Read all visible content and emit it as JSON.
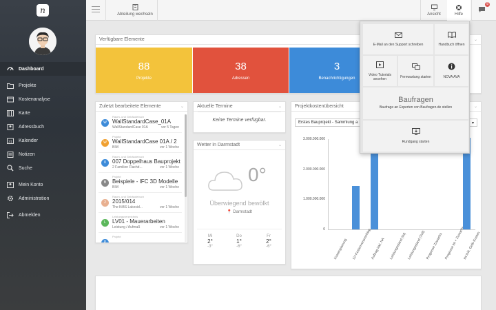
{
  "app": {
    "logo_letter": "n"
  },
  "sidebar": {
    "items": [
      {
        "label": "Dashboard",
        "icon": "speedometer-icon"
      },
      {
        "label": "Projekte",
        "icon": "folder-icon"
      },
      {
        "label": "Kostenanalyse",
        "icon": "calculator-icon"
      },
      {
        "label": "Karte",
        "icon": "map-icon"
      },
      {
        "label": "Adressbuch",
        "icon": "address-book-icon"
      },
      {
        "label": "Kalender",
        "icon": "calendar-icon"
      },
      {
        "label": "Notizen",
        "icon": "note-icon"
      },
      {
        "label": "Suche",
        "icon": "search-icon"
      },
      {
        "label": "Mein Konto",
        "icon": "account-icon"
      },
      {
        "label": "Administration",
        "icon": "gear-icon"
      },
      {
        "label": "Abmelden",
        "icon": "logout-icon"
      }
    ]
  },
  "topbar": {
    "switch_label": "Abteilung wechseln",
    "view_label": "Ansicht",
    "help_label": "Hilfe",
    "notif_count": "8"
  },
  "available": {
    "title": "Verfügbare Elemente",
    "tiles": [
      {
        "value": "88",
        "label": "Projekte",
        "color": "#f3c33b"
      },
      {
        "value": "38",
        "label": "Adressen",
        "color": "#e1523d"
      },
      {
        "value": "3",
        "label": "Benachrichtigungen",
        "color": "#3d8bd9"
      }
    ]
  },
  "recent": {
    "title": "Zuletzt bearbeitete Elemente",
    "items": [
      {
        "badge": "W",
        "color": "#3d8bd9",
        "cat": "Raum- und Gebäudebuch",
        "title": "WallStandardCase_01A",
        "sub": "WallStandardCase 01A",
        "time": "vor 5 Tagen"
      },
      {
        "badge": "W",
        "color": "#f0a030",
        "cat": "Projekt",
        "title": "WallStandardCase 01A / 2",
        "sub": "BIM",
        "time": "vor 1 Woche"
      },
      {
        "badge": "0",
        "color": "#3d8bd9",
        "cat": "Raum- und Gebäudebuch",
        "title": "007 Doppelhaus Bauprojekt",
        "sub": "2 Familien Flachd...",
        "time": "vor 1 Woche"
      },
      {
        "badge": "B",
        "color": "#888888",
        "cat": "Projekt",
        "title": "Beispiele - IFC 3D Modelle",
        "sub": "BIM",
        "time": "vor 1 Woche"
      },
      {
        "badge": "2",
        "color": "#e8b090",
        "cat": "Raum- und Gebäudebuch",
        "title": "2015/014",
        "sub": "The KiBS Lakesid...",
        "time": "vor 1 Woche"
      },
      {
        "badge": "L",
        "color": "#5cb85c",
        "cat": "Leistungsverzeichnis",
        "title": "LV01 - Mauerarbeiten",
        "sub": "Leistung / Aufmaß",
        "time": "vor 1 Woche"
      },
      {
        "badge": "P",
        "color": "#3d8bd9",
        "cat": "Projekt",
        "title": "",
        "sub": "",
        "time": ""
      }
    ]
  },
  "termine": {
    "title": "Aktuelle Termine",
    "empty": "Keine Termine verfügbar."
  },
  "weather": {
    "title": "Wetter in Darmstadt",
    "temp": "0°",
    "desc": "Überwiegend bewölkt",
    "location": "Darmstadt",
    "days": [
      {
        "day": "Mi",
        "high": "2°",
        "low": "-3°"
      },
      {
        "day": "Do",
        "high": "1°",
        "low": "-6°"
      },
      {
        "day": "Fr",
        "high": "2°",
        "low": "-6°"
      }
    ]
  },
  "costs": {
    "title": "Projektkostenübersicht",
    "select_value": "Erstes Bauprojekt - Sammlung a",
    "chart_data": {
      "type": "bar",
      "categories": [
        "Kostenplanung",
        "LV-Kostenvoranschlag",
        "Auftrag inkl. NA",
        "Leistungsstand (lst)",
        "Leistungsstand (Soll)",
        "Prognose Zuwachs",
        "Prognose lst + Zuwachs",
        "Ist inkl. Gelb-Kosten"
      ],
      "values": [
        0,
        1450000000,
        3050000000,
        0,
        0,
        0,
        0,
        3050000000
      ],
      "ylim": [
        0,
        3000000000
      ],
      "yticks": [
        "3.000.000.000",
        "2.000.000.000",
        "1.000.000.000",
        "0"
      ],
      "color": "#4a90d9"
    }
  },
  "help_menu": {
    "email": "E-Mail an den Support schreiben",
    "manual": "Handbuch öffnen",
    "video": "Video Tutorials ansehen",
    "remote": "Fernwartung starten",
    "nova": "NOVA AVA",
    "baufragen_logo": "Baufragen",
    "baufragen": "Baufrage an Experten von Baufragen.de stellen",
    "tour": "Rundgang starten"
  }
}
